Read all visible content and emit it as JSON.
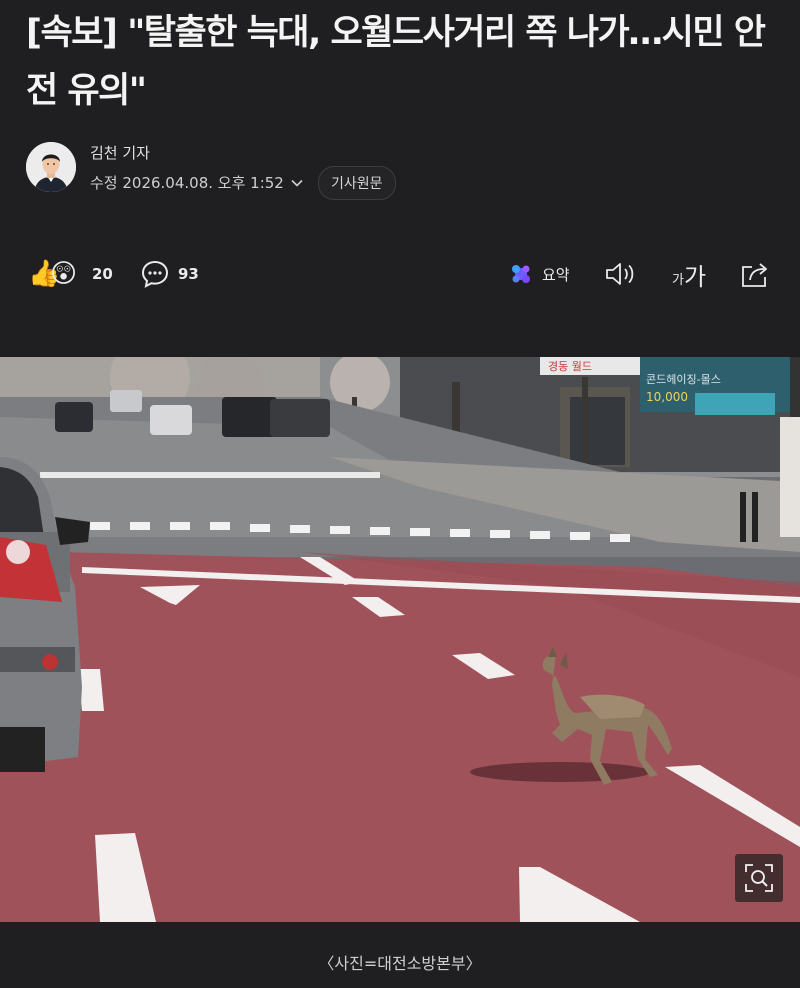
{
  "article": {
    "headline": "[속보] \"탈출한 늑대, 오월드사거리 쪽 나가…시민 안전 유의\"",
    "author": "김천 기자",
    "updated": "수정 2026.04.08. 오후 1:52",
    "original_button": "기사원문"
  },
  "toolbar": {
    "reaction_count": "20",
    "comment_count": "93",
    "summary_label": "요약",
    "font_small": "가",
    "font_large": "가"
  },
  "photo": {
    "shop_sign_1": "경동 월드",
    "shop_sign_2": "콘드헤이징-몰스",
    "shop_sign_3": "10,000"
  },
  "caption": "〈사진=대전소방본부〉",
  "colors": {
    "background": "#1f1f21",
    "road": "#a0525a",
    "accent_summary": "#5b5bff"
  }
}
